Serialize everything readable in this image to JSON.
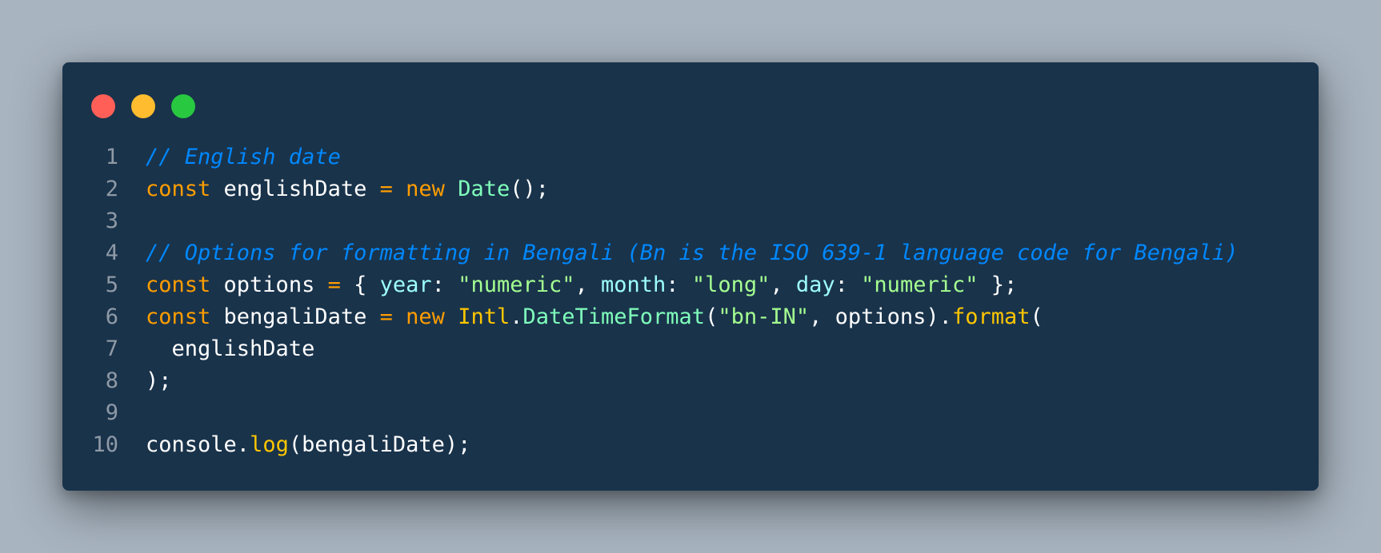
{
  "window": {
    "controls": [
      {
        "name": "close",
        "color": "#ff5f57"
      },
      {
        "name": "minimize",
        "color": "#febc2e"
      },
      {
        "name": "maximize",
        "color": "#28c840"
      }
    ]
  },
  "code": {
    "lines": [
      {
        "number": "1",
        "tokens": [
          {
            "t": "// English date",
            "k": "comment"
          }
        ]
      },
      {
        "number": "2",
        "tokens": [
          {
            "t": "const",
            "k": "keyword"
          },
          {
            "t": " englishDate ",
            "k": "plain"
          },
          {
            "t": "=",
            "k": "op"
          },
          {
            "t": " ",
            "k": "plain"
          },
          {
            "t": "new",
            "k": "keyword"
          },
          {
            "t": " ",
            "k": "plain"
          },
          {
            "t": "Date",
            "k": "class"
          },
          {
            "t": "();",
            "k": "punct"
          }
        ]
      },
      {
        "number": "3",
        "tokens": []
      },
      {
        "number": "4",
        "tokens": [
          {
            "t": "// Options for formatting in Bengali (Bn is the ISO 639-1 language code for Bengali)",
            "k": "comment"
          }
        ]
      },
      {
        "number": "5",
        "tokens": [
          {
            "t": "const",
            "k": "keyword"
          },
          {
            "t": " options ",
            "k": "plain"
          },
          {
            "t": "=",
            "k": "op"
          },
          {
            "t": " { ",
            "k": "punct"
          },
          {
            "t": "year",
            "k": "prop"
          },
          {
            "t": ": ",
            "k": "punct"
          },
          {
            "t": "\"numeric\"",
            "k": "string"
          },
          {
            "t": ", ",
            "k": "punct"
          },
          {
            "t": "month",
            "k": "prop"
          },
          {
            "t": ": ",
            "k": "punct"
          },
          {
            "t": "\"long\"",
            "k": "string"
          },
          {
            "t": ", ",
            "k": "punct"
          },
          {
            "t": "day",
            "k": "prop"
          },
          {
            "t": ": ",
            "k": "punct"
          },
          {
            "t": "\"numeric\"",
            "k": "string"
          },
          {
            "t": " };",
            "k": "punct"
          }
        ]
      },
      {
        "number": "6",
        "tokens": [
          {
            "t": "const",
            "k": "keyword"
          },
          {
            "t": " bengaliDate ",
            "k": "plain"
          },
          {
            "t": "=",
            "k": "op"
          },
          {
            "t": " ",
            "k": "plain"
          },
          {
            "t": "new",
            "k": "keyword"
          },
          {
            "t": " ",
            "k": "plain"
          },
          {
            "t": "Intl",
            "k": "class2"
          },
          {
            "t": ".",
            "k": "punct"
          },
          {
            "t": "DateTimeFormat",
            "k": "method2"
          },
          {
            "t": "(",
            "k": "punct"
          },
          {
            "t": "\"bn-IN\"",
            "k": "string"
          },
          {
            "t": ", options).",
            "k": "punct"
          },
          {
            "t": "format",
            "k": "method"
          },
          {
            "t": "(",
            "k": "punct"
          }
        ]
      },
      {
        "number": "7",
        "tokens": [
          {
            "t": "  englishDate",
            "k": "plain"
          }
        ]
      },
      {
        "number": "8",
        "tokens": [
          {
            "t": ");",
            "k": "punct"
          }
        ]
      },
      {
        "number": "9",
        "tokens": []
      },
      {
        "number": "10",
        "tokens": [
          {
            "t": "console",
            "k": "plain"
          },
          {
            "t": ".",
            "k": "punct"
          },
          {
            "t": "log",
            "k": "method"
          },
          {
            "t": "(bengaliDate);",
            "k": "punct"
          }
        ]
      }
    ]
  }
}
